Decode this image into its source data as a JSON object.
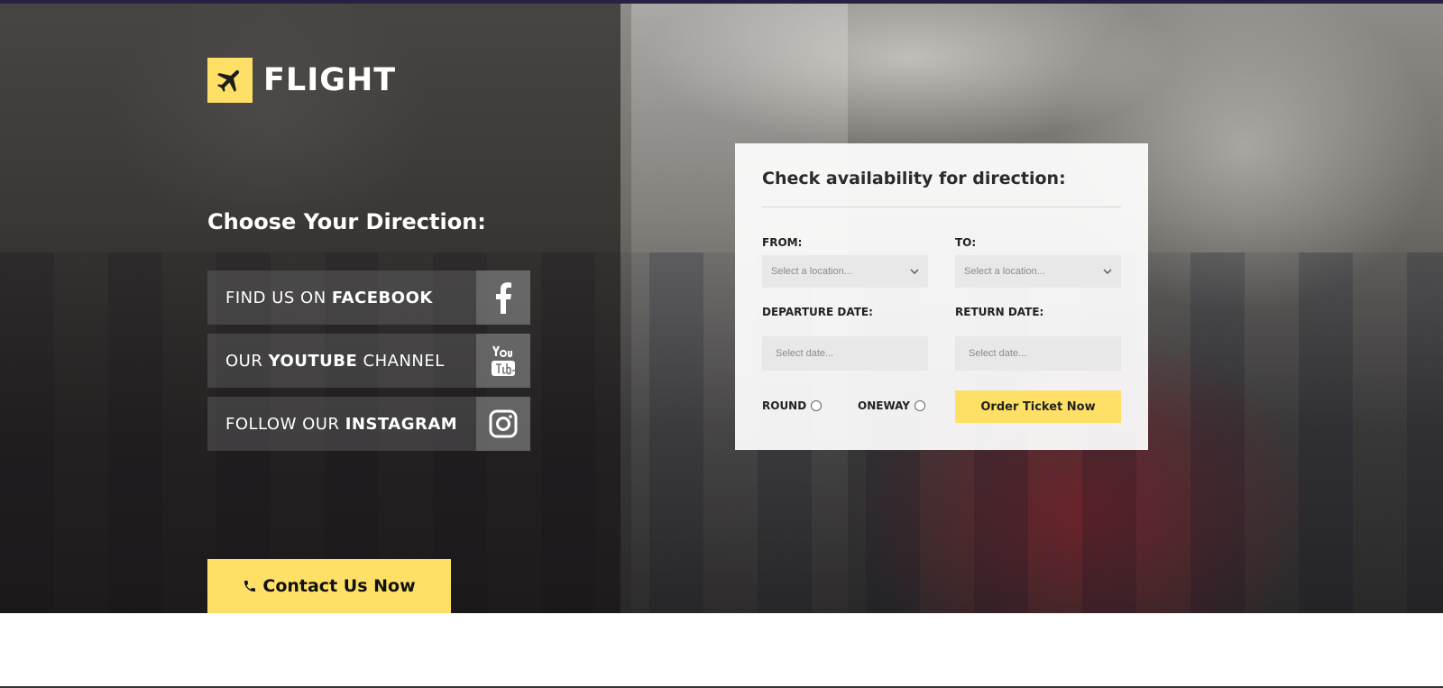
{
  "app": {
    "title": "FLIGHT"
  },
  "colors": {
    "accent": "#ffe066",
    "top_bar": "#2a2043"
  },
  "sidebar": {
    "heading": "Choose Your Direction:",
    "social": [
      {
        "prefix": "FIND US ON ",
        "bold": "FACEBOOK",
        "suffix": "",
        "icon": "facebook-icon"
      },
      {
        "prefix": "OUR ",
        "bold": "YOUTUBE",
        "suffix": " CHANNEL",
        "icon": "youtube-icon"
      },
      {
        "prefix": "FOLLOW OUR ",
        "bold": "INSTAGRAM",
        "suffix": "",
        "icon": "instagram-icon"
      }
    ],
    "contact_button": "Contact Us Now",
    "contact_icon": "phone-icon"
  },
  "form": {
    "title": "Check availability for direction:",
    "from_label": "FROM:",
    "to_label": "TO:",
    "from_placeholder": "Select a location...",
    "to_placeholder": "Select a location...",
    "departure_label": "DEPARTURE DATE:",
    "return_label": "RETURN DATE:",
    "departure_placeholder": "Select date...",
    "return_placeholder": "Select date...",
    "round_label": "ROUND",
    "oneway_label": "ONEWAY",
    "order_button": "Order Ticket Now"
  }
}
